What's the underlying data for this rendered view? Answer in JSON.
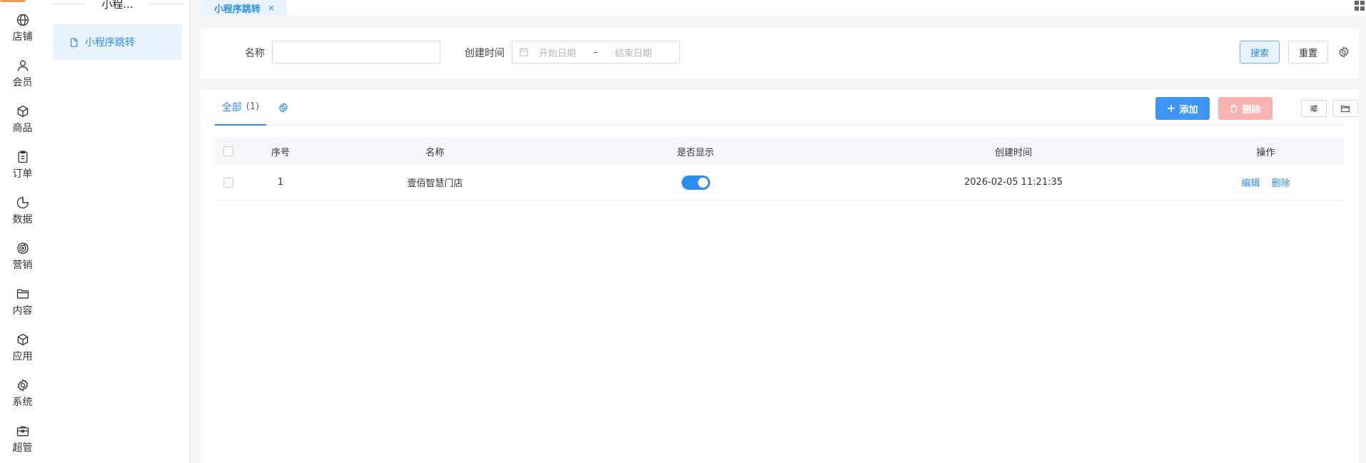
{
  "rail": {
    "items": [
      {
        "label": "店铺",
        "icon": "globe-icon"
      },
      {
        "label": "会员",
        "icon": "user-icon"
      },
      {
        "label": "商品",
        "icon": "box-icon"
      },
      {
        "label": "订单",
        "icon": "clipboard-icon"
      },
      {
        "label": "数据",
        "icon": "pie-chart-icon"
      },
      {
        "label": "营销",
        "icon": "target-icon"
      },
      {
        "label": "内容",
        "icon": "folder-icon"
      },
      {
        "label": "应用",
        "icon": "cube-icon"
      },
      {
        "label": "系统",
        "icon": "gear-icon"
      },
      {
        "label": "超管",
        "icon": "briefcase-icon"
      }
    ]
  },
  "sidebar": {
    "title": "小程...",
    "item": "小程序跳转"
  },
  "tabbar": {
    "active_tab": "小程序跳转",
    "close": "×"
  },
  "search": {
    "name_label": "名称",
    "name_value": "",
    "time_label": "创建时间",
    "start_placeholder": "开始日期",
    "separator": "–",
    "end_placeholder": "结束日期",
    "search_btn": "搜索",
    "reset_btn": "重置"
  },
  "main": {
    "tab_all": "全部",
    "tab_count": "(1)",
    "add_btn": "添加",
    "delete_btn": "删除",
    "columns": [
      "序号",
      "名称",
      "是否显示",
      "创建时间",
      "操作"
    ],
    "rows": [
      {
        "index": "1",
        "name": "壹佰智慧门店",
        "visible": true,
        "created": "2026-02-05 11:21:35",
        "edit": "编辑",
        "delete": "删除"
      }
    ]
  },
  "colors": {
    "accent": "#2d8cf0",
    "danger_light": "#f9b3b3"
  }
}
